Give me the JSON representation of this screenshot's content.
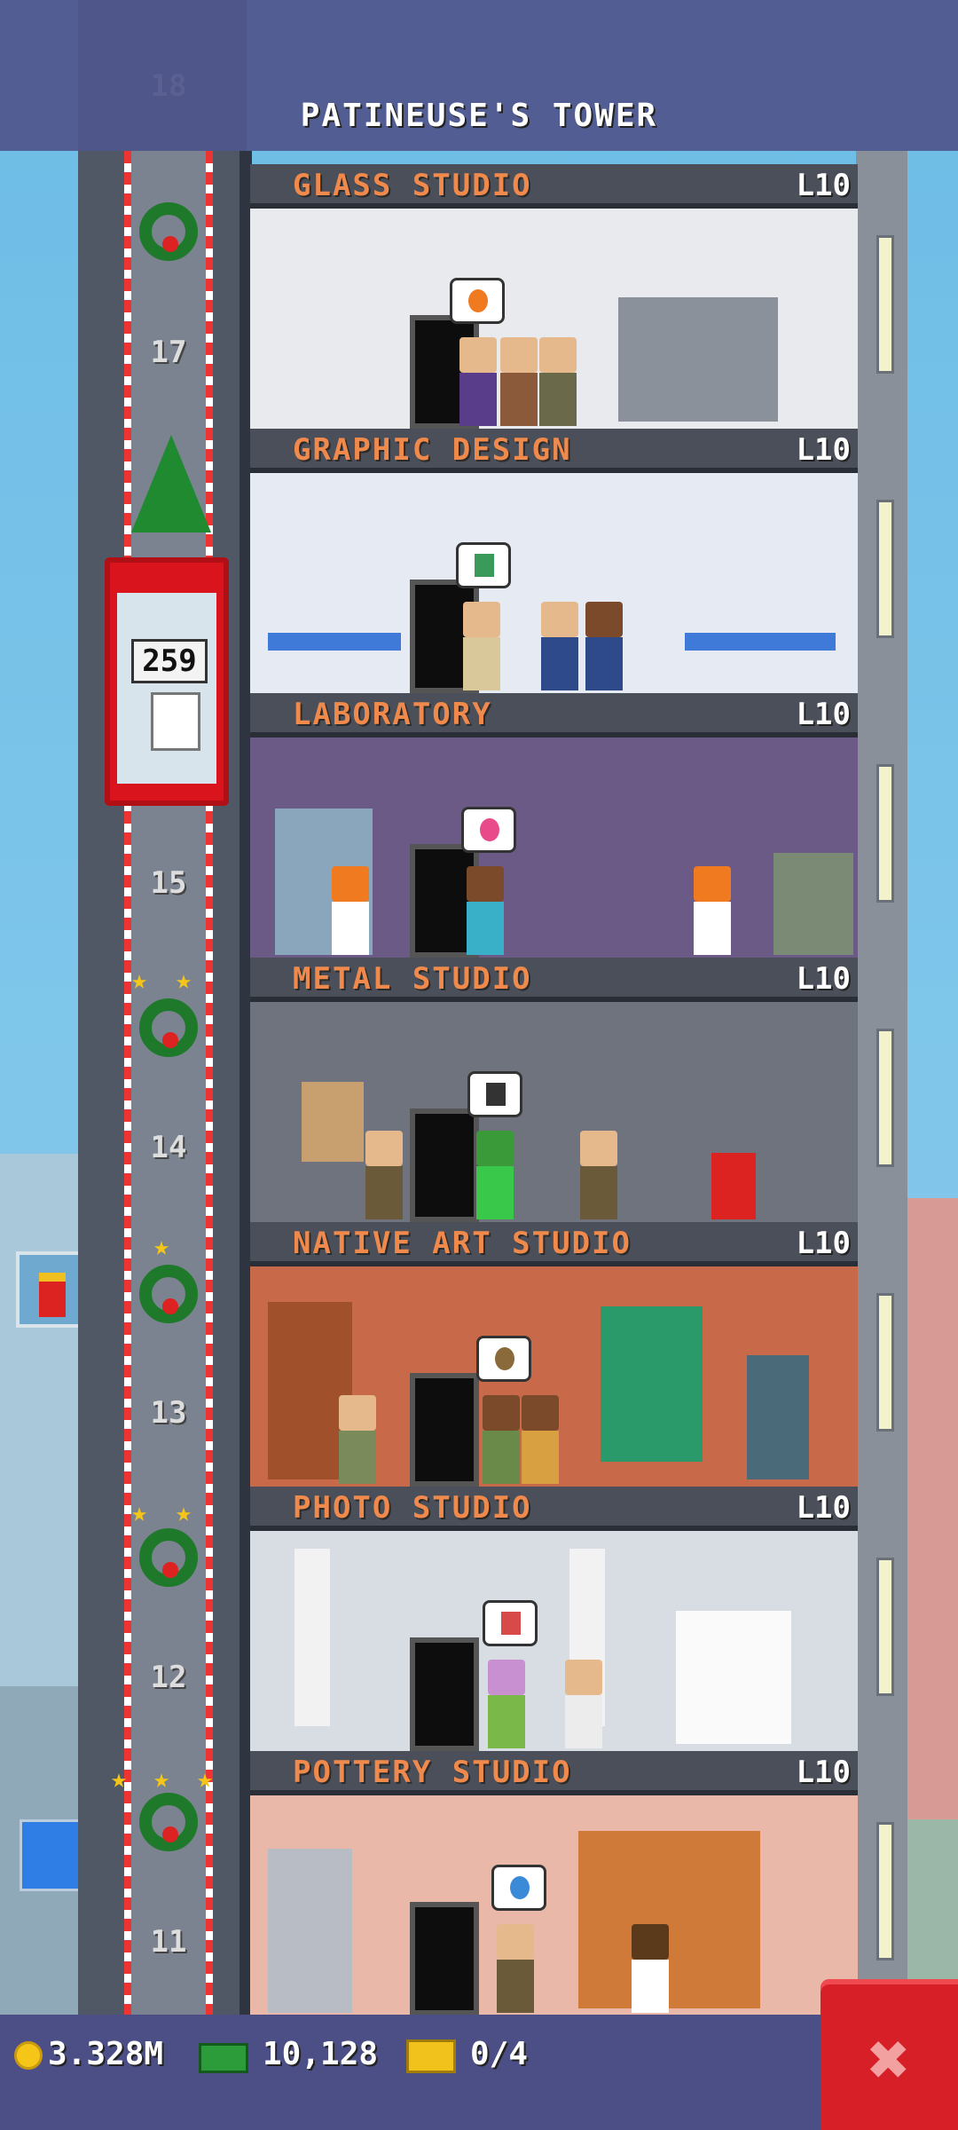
{
  "header": {
    "tower_title": "PATINEUSE'S TOWER"
  },
  "elevator": {
    "car_count": "259",
    "floor_numbers": [
      "18",
      "17",
      "15",
      "14",
      "13",
      "12",
      "11"
    ]
  },
  "floors": [
    {
      "name": "GLASS STUDIO",
      "level": "L10",
      "bg": "#e8eaee"
    },
    {
      "name": "GRAPHIC DESIGN",
      "level": "L10",
      "bg": "#e6eaf2"
    },
    {
      "name": "LABORATORY",
      "level": "L10",
      "bg": "#6b5a86"
    },
    {
      "name": "METAL STUDIO",
      "level": "L10",
      "bg": "#6e737d"
    },
    {
      "name": "NATIVE ART STUDIO",
      "level": "L10",
      "bg": "#c86a4a"
    },
    {
      "name": "PHOTO STUDIO",
      "level": "L10",
      "bg": "#d8dde4"
    },
    {
      "name": "POTTERY STUDIO",
      "level": "L10",
      "bg": "#eab8a8"
    }
  ],
  "status": {
    "coins": "3.328M",
    "cash": "10,128",
    "bux_progress": "0/4"
  },
  "icons": {
    "coin": "coin-icon",
    "cash": "cash-icon",
    "bux": "bux-ticket-icon",
    "close": "close-icon"
  },
  "colors": {
    "floor_name": "#f08a4c",
    "close_button": "#d61f27",
    "bottom_bar": "#4c4f86"
  }
}
